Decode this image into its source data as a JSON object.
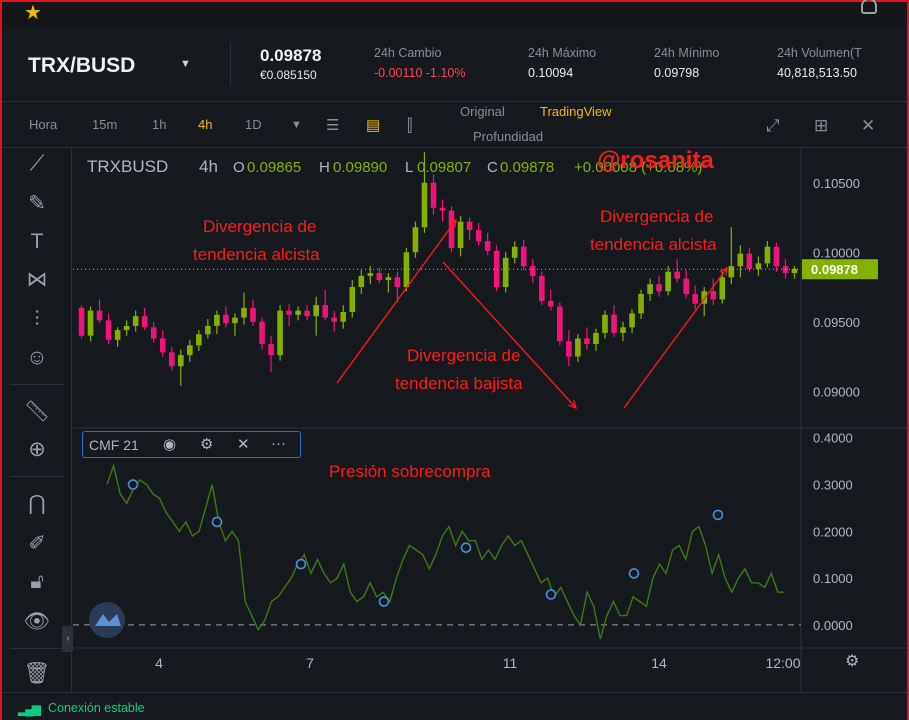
{
  "header": {
    "pair": "TRX/BUSD",
    "price": "0.09878",
    "price_eur": "€0.085150",
    "stats": [
      {
        "label": "24h Cambio",
        "value": "-0.00110 -1.10%",
        "negative": true
      },
      {
        "label": "24h Máximo",
        "value": "0.10094"
      },
      {
        "label": "24h Mínimo",
        "value": "0.09798"
      },
      {
        "label": "24h Volumen(T",
        "value": "40,818,513.50"
      }
    ]
  },
  "toolbar": {
    "timeframes": [
      "Hora",
      "15m",
      "1h",
      "4h",
      "1D"
    ],
    "active_timeframe": "4h",
    "views": [
      "Original",
      "TradingView",
      "Profundidad"
    ],
    "active_view": "TradingView"
  },
  "legend": {
    "symbol": "TRXBUSD",
    "interval": "4h",
    "open_label": "O",
    "open": "0.09865",
    "high_label": "H",
    "high": "0.09890",
    "low_label": "L",
    "low": "0.09807",
    "close_label": "C",
    "close": "0.09878",
    "change": "+0.00008 (+0.08%)"
  },
  "indicator": {
    "name": "CMF 21"
  },
  "annotations": {
    "watermark": "@rosanita",
    "div_alc_1a": "Divergencia de",
    "div_alc_1b": "tendencia alcista",
    "div_baj_a": "Divergencia de",
    "div_baj_b": "tendencia bajista",
    "div_alc_2a": "Divergencia de",
    "div_alc_2b": "tendencia alcista",
    "presion": "Presión sobrecompra"
  },
  "status": {
    "text": "Conexión estable"
  },
  "colors": {
    "up": "#84b000",
    "down": "#f0147a",
    "cmf_line": "#3c7a1a",
    "marker": "#4a90d9",
    "accent": "#f0b90b",
    "annotation": "#ff1a1a",
    "last_price_bg": "#84b000"
  },
  "chart_data": [
    {
      "type": "candlestick",
      "title": "TRXBUSD 4h",
      "x_tick_labels": [
        "4",
        "7",
        "11",
        "14",
        "12:00"
      ],
      "y_tick_labels": [
        "0.10500",
        "0.10000",
        "0.09500",
        "0.09000"
      ],
      "ylim": [
        0.0875,
        0.1075
      ],
      "last_price": "0.09878",
      "ohlc": [
        [
          0.096,
          0.0962,
          0.0938,
          0.094
        ],
        [
          0.094,
          0.0961,
          0.0936,
          0.0958
        ],
        [
          0.0958,
          0.0966,
          0.0949,
          0.0951
        ],
        [
          0.0951,
          0.0956,
          0.0934,
          0.0937
        ],
        [
          0.0937,
          0.0946,
          0.0932,
          0.0944
        ],
        [
          0.0944,
          0.0951,
          0.094,
          0.0947
        ],
        [
          0.0947,
          0.0958,
          0.0943,
          0.0954
        ],
        [
          0.0954,
          0.096,
          0.0944,
          0.0946
        ],
        [
          0.0946,
          0.095,
          0.0935,
          0.0938
        ],
        [
          0.0938,
          0.0944,
          0.0925,
          0.0928
        ],
        [
          0.0928,
          0.0932,
          0.0915,
          0.0918
        ],
        [
          0.0918,
          0.093,
          0.0904,
          0.0926
        ],
        [
          0.0926,
          0.0937,
          0.0921,
          0.0933
        ],
        [
          0.0933,
          0.0944,
          0.0929,
          0.0941
        ],
        [
          0.0941,
          0.0952,
          0.0938,
          0.0947
        ],
        [
          0.0947,
          0.0958,
          0.0941,
          0.0955
        ],
        [
          0.0955,
          0.0961,
          0.0946,
          0.0949
        ],
        [
          0.0949,
          0.0956,
          0.094,
          0.0953
        ],
        [
          0.0953,
          0.0971,
          0.0948,
          0.096
        ],
        [
          0.096,
          0.0966,
          0.0947,
          0.095
        ],
        [
          0.095,
          0.0953,
          0.093,
          0.0934
        ],
        [
          0.0934,
          0.094,
          0.0914,
          0.0926
        ],
        [
          0.0926,
          0.0962,
          0.0922,
          0.0958
        ],
        [
          0.0958,
          0.0963,
          0.0947,
          0.0955
        ],
        [
          0.0955,
          0.0961,
          0.0951,
          0.0958
        ],
        [
          0.0958,
          0.0962,
          0.0951,
          0.0954
        ],
        [
          0.0954,
          0.0968,
          0.094,
          0.0962
        ],
        [
          0.0962,
          0.0973,
          0.0951,
          0.0953
        ],
        [
          0.0953,
          0.0958,
          0.0943,
          0.095
        ],
        [
          0.095,
          0.0962,
          0.0945,
          0.0957
        ],
        [
          0.0957,
          0.098,
          0.0953,
          0.0975
        ],
        [
          0.0975,
          0.0987,
          0.097,
          0.0983
        ],
        [
          0.0983,
          0.099,
          0.0977,
          0.0985
        ],
        [
          0.0985,
          0.0989,
          0.0978,
          0.098
        ],
        [
          0.098,
          0.0985,
          0.0971,
          0.0982
        ],
        [
          0.0982,
          0.0986,
          0.0964,
          0.0975
        ],
        [
          0.0975,
          0.1003,
          0.0972,
          0.1
        ],
        [
          0.1,
          0.1022,
          0.0996,
          0.1018
        ],
        [
          0.1018,
          0.1072,
          0.1014,
          0.105
        ],
        [
          0.105,
          0.1056,
          0.1027,
          0.1032
        ],
        [
          0.1032,
          0.1038,
          0.1022,
          0.103
        ],
        [
          0.103,
          0.1033,
          0.1,
          0.1003
        ],
        [
          0.1003,
          0.1026,
          0.0997,
          0.1022
        ],
        [
          0.1022,
          0.1025,
          0.1009,
          0.1016
        ],
        [
          0.1016,
          0.1021,
          0.1005,
          0.1008
        ],
        [
          0.1008,
          0.1014,
          0.0998,
          0.1001
        ],
        [
          0.1001,
          0.1005,
          0.0972,
          0.0975
        ],
        [
          0.0975,
          0.1,
          0.0971,
          0.0996
        ],
        [
          0.0996,
          0.1008,
          0.0992,
          0.1004
        ],
        [
          0.1004,
          0.1009,
          0.0987,
          0.099
        ],
        [
          0.099,
          0.0995,
          0.0978,
          0.0983
        ],
        [
          0.0983,
          0.0986,
          0.0962,
          0.0965
        ],
        [
          0.0965,
          0.0973,
          0.0958,
          0.0961
        ],
        [
          0.0961,
          0.0964,
          0.0933,
          0.0936
        ],
        [
          0.0936,
          0.0944,
          0.0918,
          0.0925
        ],
        [
          0.0925,
          0.0941,
          0.0921,
          0.0938
        ],
        [
          0.0938,
          0.0946,
          0.093,
          0.0934
        ],
        [
          0.0934,
          0.0945,
          0.0929,
          0.0942
        ],
        [
          0.0942,
          0.0958,
          0.0938,
          0.0955
        ],
        [
          0.0955,
          0.0962,
          0.0939,
          0.0942
        ],
        [
          0.0942,
          0.095,
          0.0936,
          0.0946
        ],
        [
          0.0946,
          0.0959,
          0.0942,
          0.0956
        ],
        [
          0.0956,
          0.0973,
          0.0952,
          0.097
        ],
        [
          0.097,
          0.0981,
          0.0965,
          0.0977
        ],
        [
          0.0977,
          0.0983,
          0.0968,
          0.0972
        ],
        [
          0.0972,
          0.099,
          0.0969,
          0.0986
        ],
        [
          0.0986,
          0.0995,
          0.0978,
          0.0981
        ],
        [
          0.0981,
          0.0987,
          0.0967,
          0.097
        ],
        [
          0.097,
          0.0976,
          0.0959,
          0.0963
        ],
        [
          0.0963,
          0.0975,
          0.0954,
          0.0972
        ],
        [
          0.0972,
          0.0981,
          0.0962,
          0.0966
        ],
        [
          0.0966,
          0.0986,
          0.0963,
          0.0982
        ],
        [
          0.0982,
          0.1018,
          0.0977,
          0.099
        ],
        [
          0.099,
          0.1005,
          0.0982,
          0.0999
        ],
        [
          0.0999,
          0.1003,
          0.0986,
          0.0988
        ],
        [
          0.0988,
          0.0997,
          0.0983,
          0.0992
        ],
        [
          0.0992,
          0.1008,
          0.0989,
          0.1004
        ],
        [
          0.1004,
          0.1007,
          0.0986,
          0.099
        ],
        [
          0.099,
          0.0995,
          0.0981,
          0.0985
        ],
        [
          0.0985,
          0.099,
          0.0981,
          0.0988
        ]
      ]
    },
    {
      "type": "line",
      "title": "CMF 21",
      "y_tick_labels": [
        "0.4000",
        "0.3000",
        "0.2000",
        "0.1000",
        "0.0000"
      ],
      "ylim": [
        -0.045,
        0.41
      ],
      "values": [
        0.3,
        0.34,
        0.28,
        0.26,
        0.29,
        0.31,
        0.3,
        0.28,
        0.27,
        0.24,
        0.22,
        0.2,
        0.22,
        0.19,
        0.2,
        0.25,
        0.3,
        0.22,
        0.18,
        0.2,
        0.18,
        0.05,
        0.02,
        -0.01,
        0.01,
        0.05,
        0.06,
        0.08,
        0.1,
        0.13,
        0.15,
        0.11,
        0.14,
        0.11,
        0.09,
        0.1,
        0.13,
        0.07,
        0.05,
        0.06,
        0.09,
        0.06,
        0.07,
        0.05,
        0.1,
        0.14,
        0.17,
        0.16,
        0.15,
        0.12,
        0.15,
        0.19,
        0.21,
        0.17,
        0.2,
        0.18,
        0.18,
        0.14,
        0.16,
        0.14,
        0.17,
        0.19,
        0.17,
        0.18,
        0.15,
        0.12,
        0.09,
        0.1,
        0.06,
        0.08,
        0.05,
        0.02,
        0.0,
        0.07,
        0.04,
        -0.03,
        0.02,
        0.05,
        0.02,
        0.02,
        0.06,
        0.05,
        0.04,
        0.1,
        0.13,
        0.11,
        0.16,
        0.17,
        0.14,
        0.2,
        0.21,
        0.17,
        0.11,
        0.15,
        0.1,
        0.07,
        0.1,
        0.12,
        0.09,
        0.09,
        0.08,
        0.11,
        0.07,
        0.07
      ],
      "markers": [
        0.3,
        0.22,
        0.13,
        0.05,
        0.165,
        0.065,
        0.11,
        0.235
      ]
    }
  ]
}
